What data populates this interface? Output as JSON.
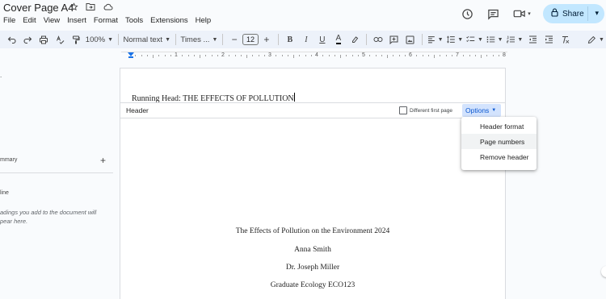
{
  "title_bar": {
    "doc_title": "Cover Page A4",
    "icons": [
      "star-icon",
      "move-folder-icon",
      "cloud-status-icon"
    ]
  },
  "menu": [
    "File",
    "Edit",
    "View",
    "Insert",
    "Format",
    "Tools",
    "Extensions",
    "Help"
  ],
  "right_controls": {
    "share_label": "Share",
    "icons": [
      "history-icon",
      "comment-icon",
      "meet-icon"
    ]
  },
  "toolbar": {
    "zoom": "100%",
    "style": "Normal text",
    "font": "Times ...",
    "font_size": "12",
    "bold": "B",
    "italic": "I",
    "underline": "U",
    "text_color": "A"
  },
  "ruler": {
    "numbers": [
      "1",
      "2",
      "3",
      "4",
      "5",
      "6",
      "7",
      "8"
    ]
  },
  "outline": {
    "summary_label": "mmary",
    "add": "+",
    "outline_label": "line",
    "hint": "adings you add to the document will\npear here."
  },
  "page": {
    "running_head": "Running Head: THE EFFECTS OF POLLUTION",
    "header_label": "Header",
    "different_first_page": "Different first page",
    "options_label": "Options",
    "lines": [
      "The Effects of Pollution on the Environment 2024",
      "Anna Smith",
      "Dr. Joseph Miller",
      "Graduate Ecology ECO123"
    ]
  },
  "options_menu": {
    "items": [
      "Header format",
      "Page numbers",
      "Remove header"
    ]
  },
  "colors": {
    "share_bg": "#c2e7ff",
    "toolbar_bg": "#edf2fa",
    "options_bg": "#d3e3fd",
    "accent": "#0b57d0"
  }
}
